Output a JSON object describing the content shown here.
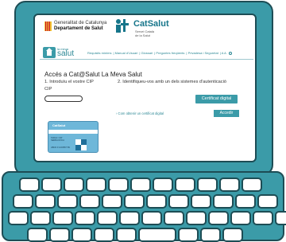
{
  "header": {
    "gov_line1": "Generalitat de Catalunya",
    "gov_line2": "Departament de Salut",
    "brand": "CatSalut",
    "brand_sub1": "Servei Català",
    "brand_sub2": "de la Salut"
  },
  "nav": {
    "logo_small": "la meva",
    "logo_big": "salut",
    "links": [
      "Requisits mínims",
      "Manual d'Usuari",
      "Glossari",
      "Preguntes freqüents",
      "Privadesa i Seguretat"
    ],
    "font_size_label": "A A"
  },
  "main": {
    "title": "Accés a Cat@Salut La Meva Salut",
    "step1": "1. Introduïu el vostre CIP",
    "step2": "2. Identifiqueu-vos amb un dels sistemes d'autenticació",
    "cip_label": "CIP",
    "cip_value": "",
    "certificate_button": "Certificat digital",
    "obtain_link": "› Com obtenir un certificat digital",
    "access_button": "Accedir"
  },
  "card": {
    "logo": "CatSalut",
    "name_line1": "TARJA I CIP",
    "name_line2": "SERRA ROCA",
    "number": "ABCD 0 1234567 89"
  },
  "colors": {
    "accent": "#3b9ba8",
    "outline": "#1d4d55"
  }
}
